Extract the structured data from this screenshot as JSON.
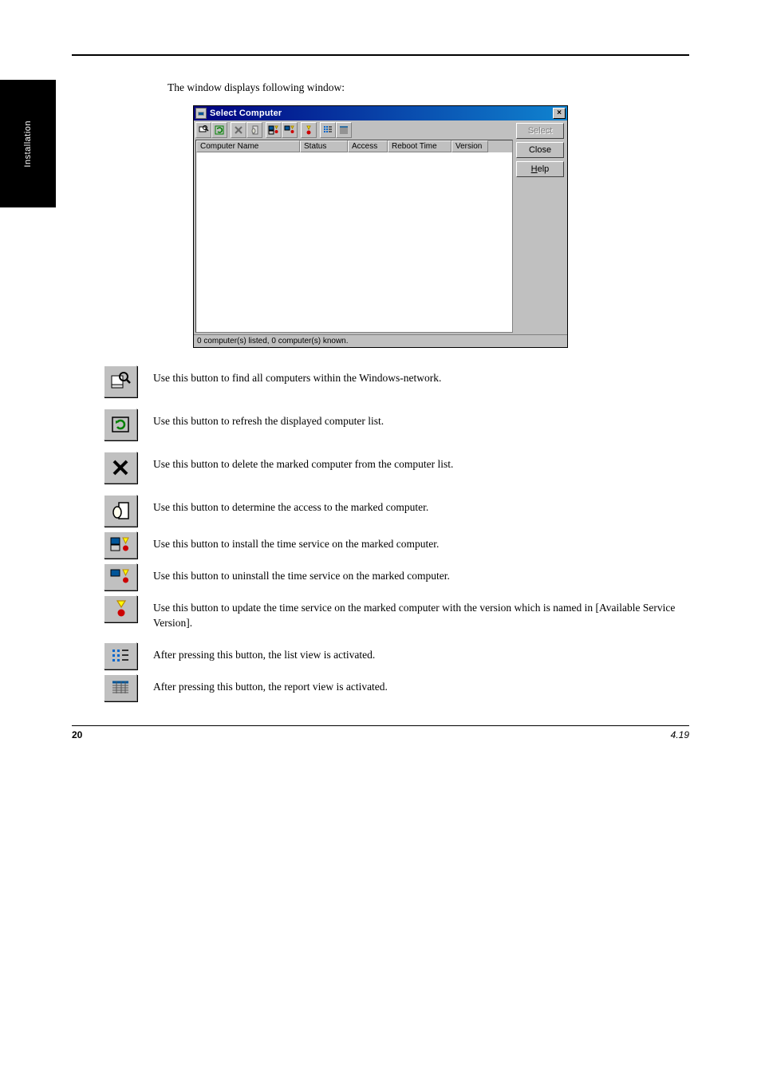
{
  "side_tab": "Installation",
  "intro": "The window displays following window:",
  "window": {
    "title": "Select Computer",
    "columns": [
      "Computer Name",
      "Status",
      "Access",
      "Reboot Time",
      "Version"
    ],
    "status": "0 computer(s) listed, 0 computer(s) known.",
    "buttons": {
      "select": "Select",
      "close": "Close",
      "help": "Help"
    }
  },
  "legend": [
    {
      "icon": "find",
      "text": "Use this button to find all computers within the Windows-network."
    },
    {
      "icon": "refresh",
      "text": "Use this button to refresh the displayed computer list."
    },
    {
      "icon": "delete",
      "text": "Use this button to delete the marked computer from the computer list."
    },
    {
      "icon": "access",
      "text": "Use this button to determine the access to the marked computer."
    },
    {
      "icon": "install",
      "text": "Use this button to install the time service on the marked computer."
    },
    {
      "icon": "uninstall",
      "text": "Use this button to uninstall the time service on the marked computer."
    },
    {
      "icon": "update",
      "text": "Use this button to update the time service on the marked computer with the version which is named in [Available Service Version]."
    },
    {
      "icon": "list",
      "text": "After pressing this button, the list view is activated."
    },
    {
      "icon": "details",
      "text": "After pressing this button, the report view is activated."
    }
  ],
  "footer": {
    "left": "20",
    "right": "4.19"
  }
}
